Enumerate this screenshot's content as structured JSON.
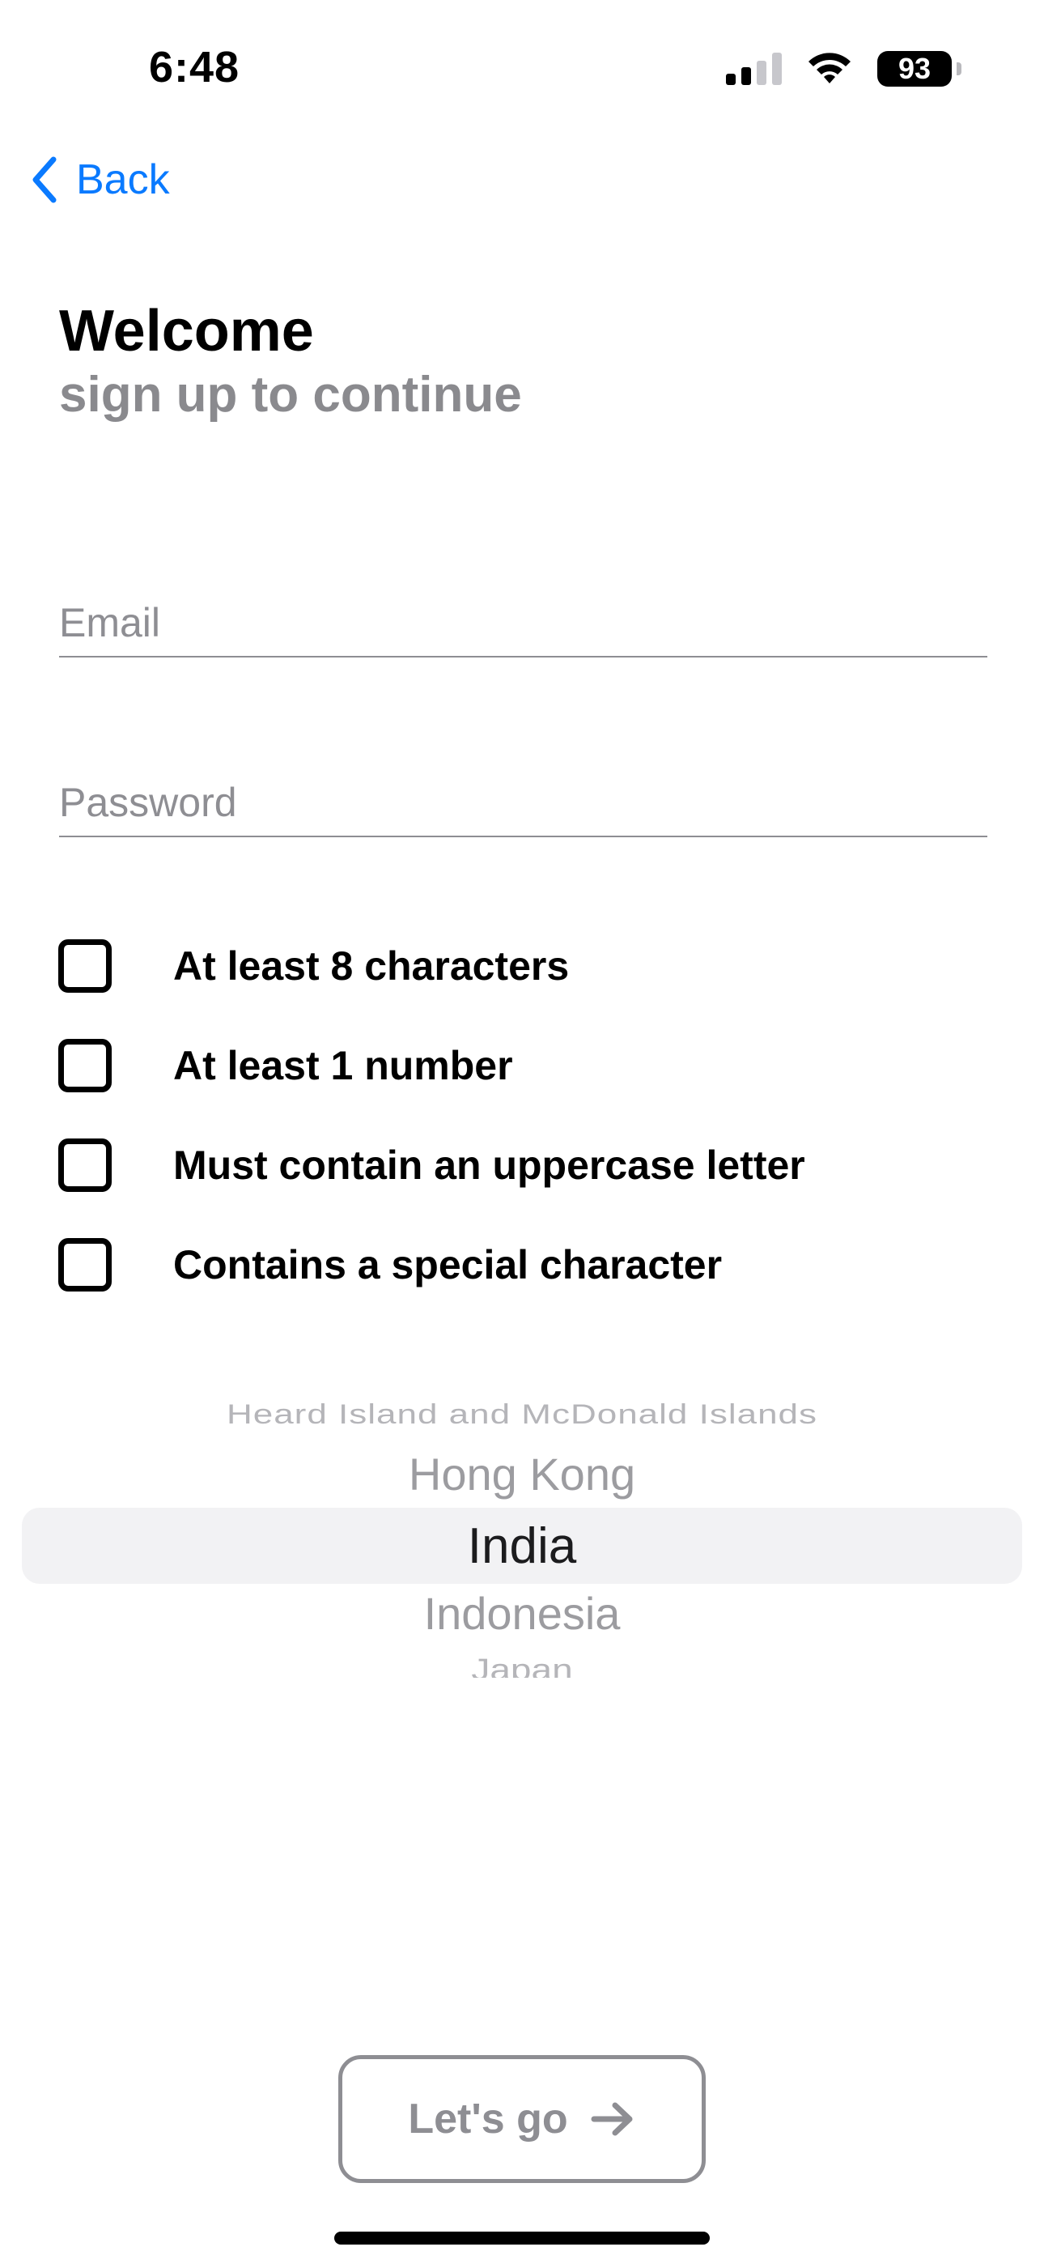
{
  "status_bar": {
    "time": "6:48",
    "battery": "93",
    "icons": [
      "signal-icon",
      "wifi-icon",
      "battery-icon"
    ]
  },
  "nav": {
    "back_label": "Back",
    "back_icon": "chevron-left-icon"
  },
  "header": {
    "title": "Welcome",
    "subtitle": "sign up to continue"
  },
  "form": {
    "email_placeholder": "Email",
    "password_placeholder": "Password",
    "email_value": "",
    "password_value": ""
  },
  "requirements": [
    {
      "label": "At least 8 characters",
      "checked": false
    },
    {
      "label": "At least 1 number",
      "checked": false
    },
    {
      "label": "Must contain an uppercase letter",
      "checked": false
    },
    {
      "label": "Contains a special character",
      "checked": false
    }
  ],
  "country_picker": {
    "items": [
      "Heard Island and McDonald Islands",
      "Hong Kong",
      "India",
      "Indonesia",
      "Japan"
    ],
    "selected": "India"
  },
  "cta": {
    "label": "Let's go",
    "icon": "arrow-right-icon"
  },
  "colors": {
    "accent": "#0A7AFF",
    "secondary_text": "#8A8A8E",
    "disabled": "#8E8E93"
  }
}
